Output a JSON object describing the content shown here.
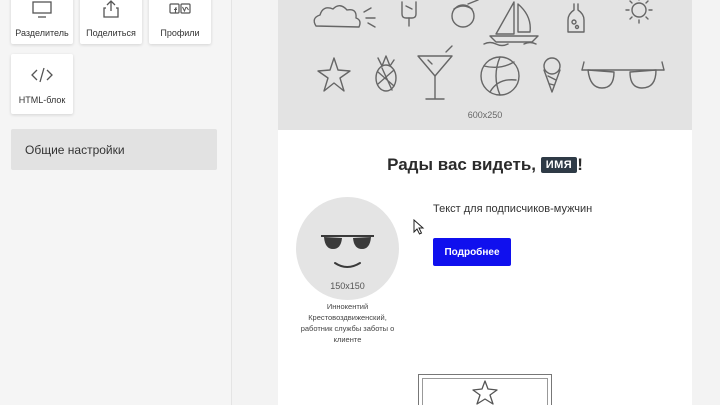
{
  "sidebar": {
    "blocks": [
      {
        "label": "Разделитель",
        "icon": "divider-icon"
      },
      {
        "label": "Поделиться",
        "icon": "share-icon"
      },
      {
        "label": "Профили",
        "icon": "social-profiles-icon"
      },
      {
        "label": "HTML-блок",
        "icon": "html-code-icon"
      }
    ],
    "general_settings": "Общие настройки"
  },
  "email": {
    "banner": {
      "size_label": "600x250",
      "icons": [
        "cloud-icon",
        "popsicle-icon",
        "coconut-drink-icon",
        "sailboat-icon",
        "bottle-icon",
        "sun-icon",
        "starfish-icon",
        "pineapple-icon",
        "cocktail-icon",
        "beach-ball-icon",
        "ice-cream-icon",
        "sunglasses-icon"
      ]
    },
    "greeting": {
      "text": "Рады вас видеть, ",
      "name_tag": "ИМЯ",
      "suffix": "!"
    },
    "avatar": {
      "size_label": "150x150",
      "caption": "Иннокентий Крестовоздвиженский, работник службы заботы о клиенте"
    },
    "body_text": "Текст для подписчиков-мужчин",
    "button_label": "Подробнее"
  },
  "colors": {
    "accent": "#1010ee",
    "name_tag_bg": "#2e3a46",
    "banner_bg": "#e3e3e3"
  }
}
